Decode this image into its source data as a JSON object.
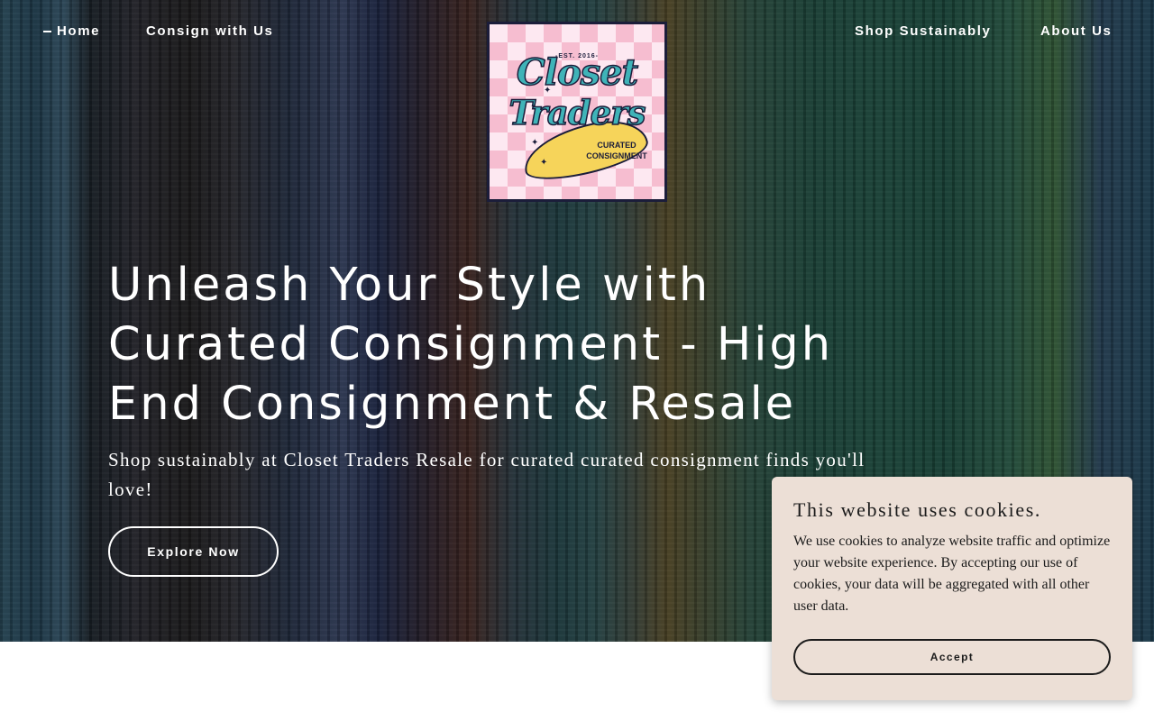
{
  "nav": {
    "home": "Home",
    "consign": "Consign with Us",
    "shop": "Shop Sustainably",
    "about": "About Us"
  },
  "logo": {
    "est": "-EST. 2016-",
    "word1": "Closet",
    "word2": "Traders",
    "sub": "CURATED CONSIGNMENT"
  },
  "hero": {
    "title": "Unleash Your Style with Curated Consignment - High End Consignment & Resale",
    "subtitle": "Shop sustainably at Closet Traders Resale for curated curated consignment finds you'll love!",
    "button": "Explore Now"
  },
  "cookie": {
    "title": "This website uses cookies.",
    "body": "We use cookies to analyze website traffic and optimize your website experience. By accepting our use of cookies, your data will be aggregated with all other user data.",
    "accept": "Accept"
  },
  "colors": {
    "logo_border": "#1b1d3a",
    "logo_teal": "#3fb3b8",
    "logo_pink": "#f6bdd0",
    "logo_yellow": "#f6d45a",
    "cookie_bg": "#ecdfd6"
  }
}
